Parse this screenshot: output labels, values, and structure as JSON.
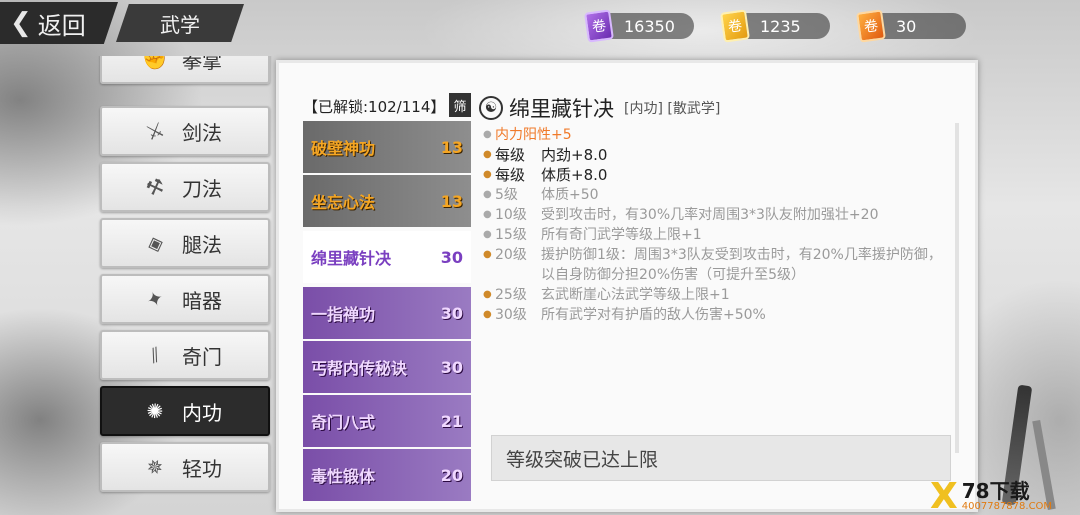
{
  "header": {
    "back_label": "返回",
    "title": "武学",
    "currencies": [
      {
        "icon": "purple-scroll-icon",
        "value": "16350"
      },
      {
        "icon": "gold-scroll-icon",
        "value": "1235"
      },
      {
        "icon": "orange-scroll-icon",
        "value": "30"
      }
    ]
  },
  "categories": [
    {
      "label": "拳掌",
      "icon": "fist-icon",
      "active": false
    },
    {
      "label": "剑法",
      "icon": "sword-icon",
      "active": false
    },
    {
      "label": "刀法",
      "icon": "blade-icon",
      "active": false
    },
    {
      "label": "腿法",
      "icon": "kick-icon",
      "active": false
    },
    {
      "label": "暗器",
      "icon": "shuriken-icon",
      "active": false
    },
    {
      "label": "奇门",
      "icon": "staff-icon",
      "active": false
    },
    {
      "label": "内功",
      "icon": "meditation-icon",
      "active": true
    },
    {
      "label": "轻功",
      "icon": "leap-icon",
      "active": false
    }
  ],
  "skill_list": {
    "unlocked_label": "【已解锁:102/114】",
    "filter_label": "筛",
    "items": [
      {
        "name": "破壁神功",
        "level": "13",
        "rarity": "gold"
      },
      {
        "name": "坐忘心法",
        "level": "13",
        "rarity": "gold"
      },
      {
        "name": "绵里藏针决",
        "level": "30",
        "rarity": "purple",
        "selected": true
      },
      {
        "name": "一指禅功",
        "level": "30",
        "rarity": "purple"
      },
      {
        "name": "丐帮内传秘诀",
        "level": "30",
        "rarity": "purple"
      },
      {
        "name": "奇门八式",
        "level": "21",
        "rarity": "purple"
      },
      {
        "name": "毒性锻体",
        "level": "20",
        "rarity": "purple"
      }
    ]
  },
  "detail": {
    "name": "绵里藏针决",
    "tags": "[内功] [散武学]",
    "effects": [
      {
        "style": "orange",
        "level": "",
        "text": "内力阳性+5"
      },
      {
        "style": "bold",
        "level": "每级",
        "text": "内劲+8.0"
      },
      {
        "style": "bold",
        "level": "每级",
        "text": "体质+8.0"
      },
      {
        "style": "gray",
        "level": "5级",
        "text": "体质+50"
      },
      {
        "style": "gray",
        "level": "10级",
        "text": "受到攻击时，有30%几率对周围3*3队友附加强壮+20"
      },
      {
        "style": "gray",
        "level": "15级",
        "text": "所有奇门武学等级上限+1"
      },
      {
        "style": "gray",
        "level": "20级",
        "text": "援护防御1级：周围3*3队友受到攻击时，有20%几率援护防御，以自身防御分担20%伤害（可提升至5级）"
      },
      {
        "style": "gray",
        "level": "25级",
        "text": "玄武断崖心法武学等级上限+1"
      },
      {
        "style": "gray",
        "level": "30级",
        "text": "所有武学对有护盾的敌人伤害+50%"
      }
    ],
    "break_status": "等级突破已达上限"
  },
  "watermark": {
    "logo": "X",
    "main": "78下载",
    "sub": "4007787878.COM"
  }
}
